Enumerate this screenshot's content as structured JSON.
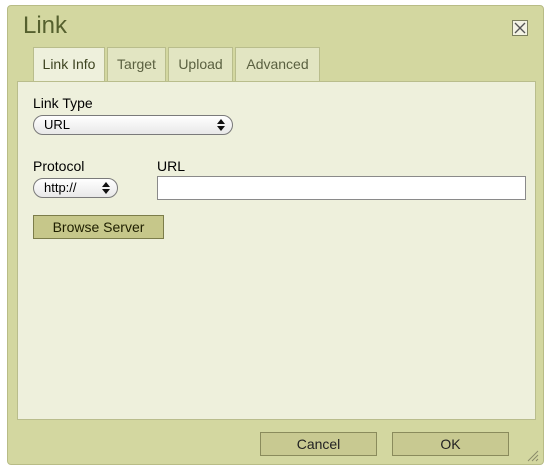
{
  "dialog": {
    "title": "Link",
    "close_icon": "close-x-icon"
  },
  "tabs": [
    {
      "label": "Link Info",
      "active": true
    },
    {
      "label": "Target",
      "active": false
    },
    {
      "label": "Upload",
      "active": false
    },
    {
      "label": "Advanced",
      "active": false
    }
  ],
  "link_type": {
    "label": "Link Type",
    "selected": "URL"
  },
  "protocol": {
    "label": "Protocol",
    "selected": "http://"
  },
  "url": {
    "label": "URL",
    "value": ""
  },
  "browse_button": "Browse Server",
  "footer": {
    "cancel_label": "Cancel",
    "ok_label": "OK"
  },
  "colors": {
    "dialog_bg": "#d3d7a0",
    "panel_bg": "#eef0dc",
    "title": "#55602e"
  }
}
